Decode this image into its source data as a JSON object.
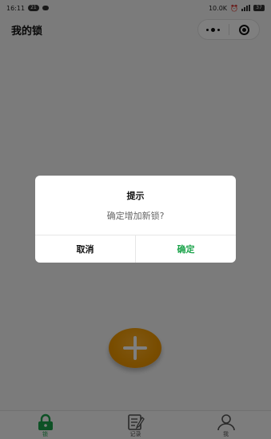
{
  "status_bar": {
    "time": "16:11",
    "badge": "21",
    "network_speed": "10.0K",
    "battery": "37"
  },
  "header": {
    "title": "我的锁"
  },
  "tabs": [
    {
      "label": "锁",
      "icon": "lock-icon",
      "active": true
    },
    {
      "label": "记录",
      "icon": "record-icon",
      "active": false
    },
    {
      "label": "我",
      "icon": "person-icon",
      "active": false
    }
  ],
  "colors": {
    "accent": "#1aa34a",
    "fab": "#f29a00"
  },
  "dialog": {
    "title": "提示",
    "content": "确定增加新锁?",
    "cancel_label": "取消",
    "confirm_label": "确定"
  }
}
